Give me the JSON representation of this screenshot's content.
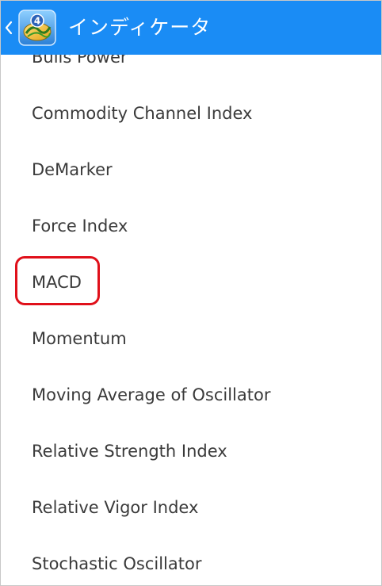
{
  "actionbar": {
    "title": "インディケータ",
    "back_icon": "chevron-left-icon",
    "logo_icon": "metatrader-4-logo",
    "logo_badge": "4",
    "background_color": "#1a8cf5"
  },
  "indicators": {
    "items": [
      {
        "label": "Bulls Power"
      },
      {
        "label": "Commodity Channel Index"
      },
      {
        "label": "DeMarker"
      },
      {
        "label": "Force Index"
      },
      {
        "label": "MACD",
        "highlighted": true
      },
      {
        "label": "Momentum"
      },
      {
        "label": "Moving Average of Oscillator"
      },
      {
        "label": "Relative Strength Index"
      },
      {
        "label": "Relative Vigor Index"
      },
      {
        "label": "Stochastic Oscillator"
      }
    ]
  },
  "highlight": {
    "target": "MACD",
    "color": "#e0101a"
  }
}
